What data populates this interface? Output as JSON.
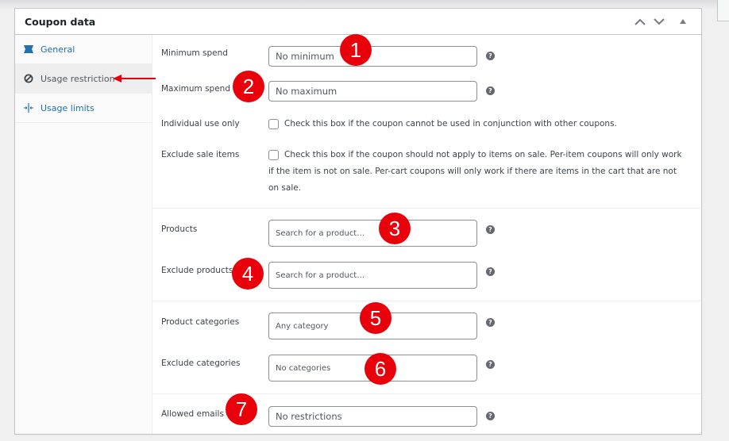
{
  "panel": {
    "title": "Coupon data",
    "header_buttons": [
      "move-up",
      "move-down",
      "collapse"
    ]
  },
  "sidebar": {
    "items": [
      {
        "label": "General",
        "icon": "ticket-icon",
        "active": false
      },
      {
        "label": "Usage restriction",
        "icon": "ban-icon",
        "active": true
      },
      {
        "label": "Usage limits",
        "icon": "limits-icon",
        "active": false
      }
    ]
  },
  "fields": {
    "minimum_spend": {
      "label": "Minimum spend",
      "placeholder": "No minimum"
    },
    "maximum_spend": {
      "label": "Maximum spend",
      "placeholder": "No maximum"
    },
    "individual_use": {
      "label": "Individual use only",
      "checked": false,
      "description": "Check this box if the coupon cannot be used in conjunction with other coupons."
    },
    "exclude_sale": {
      "label": "Exclude sale items",
      "checked": false,
      "description": "Check this box if the coupon should not apply to items on sale. Per-item coupons will only work if the item is not on sale. Per-cart coupons will only work if there are items in the cart that are not on sale."
    },
    "products": {
      "label": "Products",
      "placeholder": "Search for a product…"
    },
    "exclude_products": {
      "label": "Exclude products",
      "placeholder": "Search for a product…"
    },
    "product_categories": {
      "label": "Product categories",
      "placeholder": "Any category"
    },
    "exclude_categories": {
      "label": "Exclude categories",
      "placeholder": "No categories"
    },
    "allowed_emails": {
      "label": "Allowed emails",
      "placeholder": "No restrictions"
    }
  },
  "help_glyph": "?",
  "annotations": {
    "markers": [
      "1",
      "2",
      "3",
      "4",
      "5",
      "6",
      "7"
    ],
    "color": "#e8000b"
  }
}
